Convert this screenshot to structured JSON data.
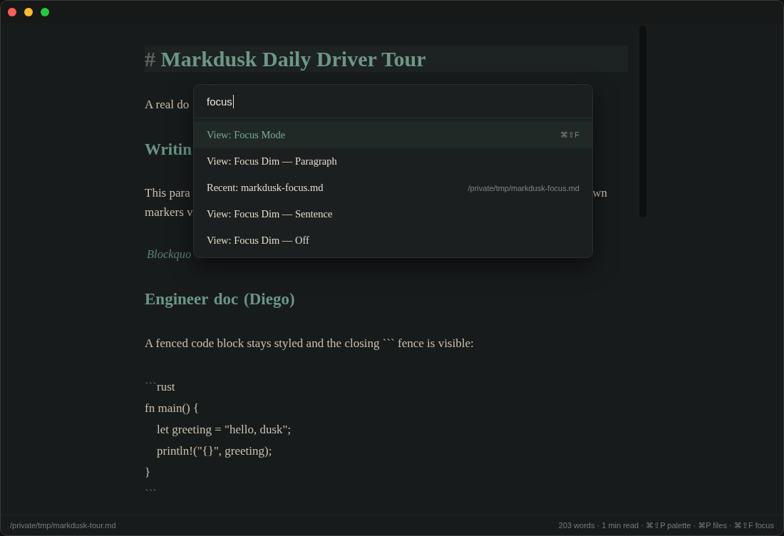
{
  "document": {
    "blocks": [
      {
        "kind": "h1",
        "marker": "#",
        "text": "Markdusk Daily Driver Tour"
      },
      {
        "kind": "p",
        "lines": [
          {
            "start": "A real do"
          }
        ]
      },
      {
        "kind": "h2",
        "text": "Writin"
      },
      {
        "kind": "p",
        "lines": [
          {
            "start": "This para",
            "end": "wn"
          },
          {
            "start": "markers v"
          }
        ]
      },
      {
        "kind": "quote",
        "text": "Blockquo"
      },
      {
        "kind": "h2",
        "text": "Engineer doc (Diego)"
      },
      {
        "kind": "p",
        "lines": [
          {
            "start": "A fenced code block stays styled and the closing ``` fence is visible:"
          }
        ]
      },
      {
        "kind": "code",
        "lines": [
          {
            "kind": "fence",
            "marker": "```",
            "text": "rust"
          },
          {
            "kind": "code",
            "text": "fn main() {"
          },
          {
            "kind": "code",
            "text": "    let greeting = \"hello, dusk\";"
          },
          {
            "kind": "code",
            "text": "    println!(\"{}\", greeting);"
          },
          {
            "kind": "code",
            "text": "}"
          },
          {
            "kind": "fence",
            "marker": "```"
          }
        ]
      }
    ]
  },
  "command_palette": {
    "search": {
      "value": "focus"
    },
    "items": [
      {
        "label": "View: Focus Mode",
        "shortcut": "⌘⇧F",
        "selected": true
      },
      {
        "label": "View: Focus Dim — Paragraph",
        "selected": false
      },
      {
        "label": "Recent: markdusk-focus.md",
        "path": "/private/tmp/markdusk-focus.md",
        "selected": false
      },
      {
        "label": "View: Focus Dim — Sentence",
        "selected": false
      },
      {
        "label": "View: Focus Dim — Off",
        "selected": false
      }
    ]
  },
  "status_bar": {
    "path": "/private/tmp/markdusk-tour.md",
    "info": "203 words · 1 min read · ⌘⇧P palette · ⌘P files · ⌘⇧F focus"
  }
}
